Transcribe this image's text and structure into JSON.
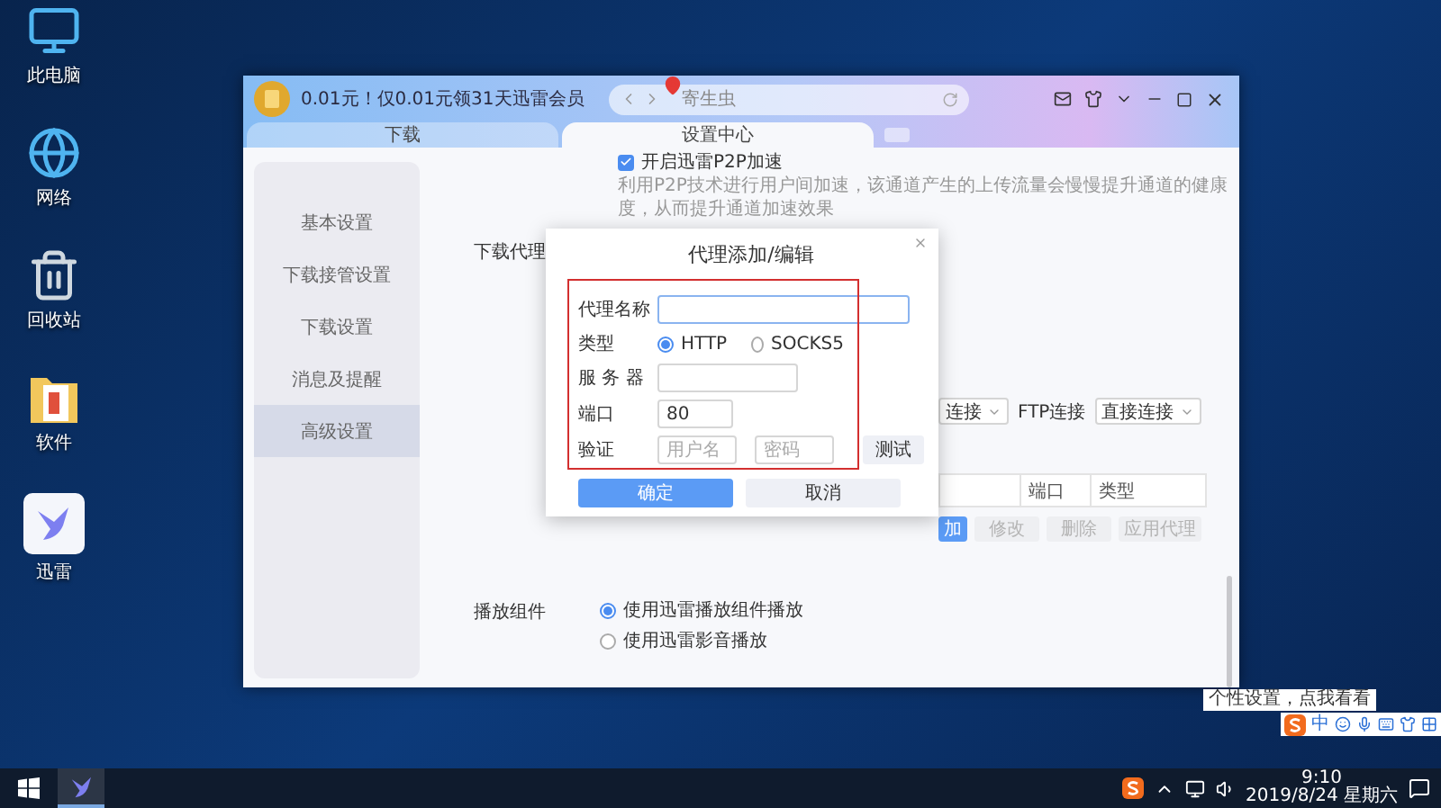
{
  "desktop_icons": [
    {
      "label": "此电脑",
      "kind": "computer"
    },
    {
      "label": "网络",
      "kind": "network"
    },
    {
      "label": "回收站",
      "kind": "recycle"
    },
    {
      "label": "软件",
      "kind": "folder"
    },
    {
      "label": "迅雷",
      "kind": "app"
    }
  ],
  "app_window": {
    "promo_text": "0.01元！仅0.01元领31天迅雷会员",
    "address_bar": {
      "value": "寄生虫"
    },
    "tabs": [
      {
        "label": "下载",
        "selected": false
      },
      {
        "label": "设置中心",
        "selected": true
      }
    ],
    "sidebar": {
      "items": [
        {
          "label": "基本设置",
          "selected": false
        },
        {
          "label": "下载接管设置",
          "selected": false
        },
        {
          "label": "下载设置",
          "selected": false
        },
        {
          "label": "消息及提醒",
          "selected": false
        },
        {
          "label": "高级设置",
          "selected": true
        }
      ]
    },
    "p2p": {
      "label": "开启迅雷P2P加速",
      "checked": true,
      "description": "利用P2P技术进行用户间加速，该通道产生的上传流量会慢慢提升通道的健康度，从而提升通道加速效果"
    },
    "proxy": {
      "label": "下载代理",
      "http_select": "连接",
      "ftp_label": "FTP连接",
      "ftp_select": "直接连接",
      "table_columns": [
        "端口",
        "类型"
      ],
      "buttons": [
        {
          "label": "加",
          "disabled": false
        },
        {
          "label": "修改",
          "disabled": true
        },
        {
          "label": "删除",
          "disabled": true
        },
        {
          "label": "应用代理",
          "disabled": true
        }
      ]
    },
    "player": {
      "label": "播放组件",
      "options": [
        {
          "label": "使用迅雷播放组件播放",
          "selected": true
        },
        {
          "label": "使用迅雷影音播放",
          "selected": false
        }
      ]
    }
  },
  "dialog": {
    "title": "代理添加/编辑",
    "name_label": "代理名称",
    "name_focused": true,
    "type_label": "类型",
    "type_options": [
      {
        "label": "HTTP",
        "selected": true
      },
      {
        "label": "SOCKS5",
        "selected": false
      }
    ],
    "server_label": "服 务 器",
    "port_label": "端口",
    "port_value": "80",
    "auth_label": "验证",
    "username_placeholder": "用户名",
    "password_placeholder": "密码",
    "test_button": "测试",
    "confirm_button": "确定",
    "cancel_button": "取消"
  },
  "ime_tooltip": "个性设置，点我看看",
  "ime_toolbar": {
    "mode": "中"
  },
  "taskbar": {
    "time": "9:10",
    "date": "2019/8/24 星期六"
  }
}
